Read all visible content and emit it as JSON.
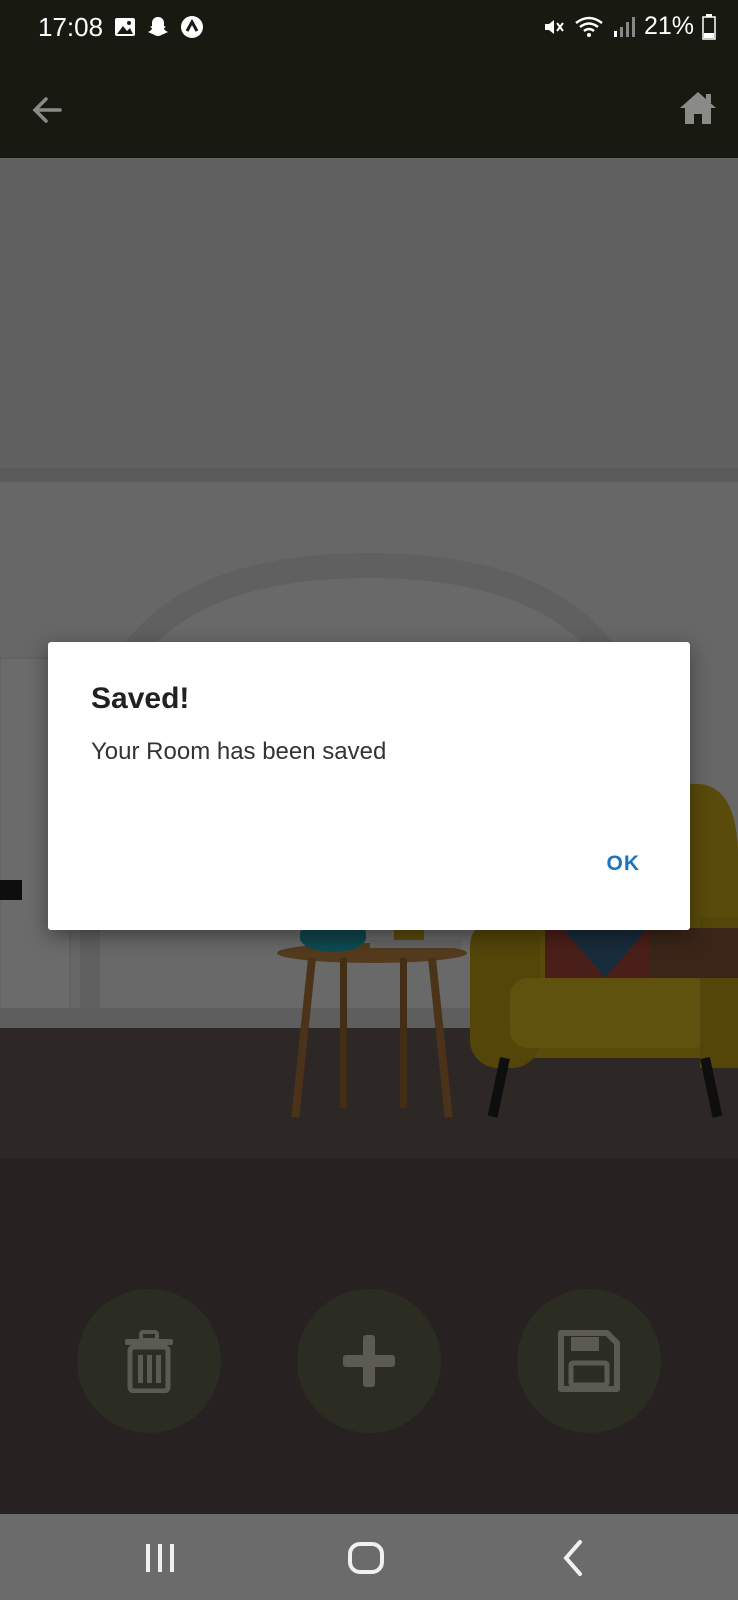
{
  "status_bar": {
    "time": "17:08",
    "battery": "21%",
    "left_icons": [
      "image-icon",
      "snapchat-icon",
      "app-icon"
    ],
    "right_icons": [
      "mute-icon",
      "wifi-icon",
      "signal-icon",
      "battery-icon"
    ]
  },
  "app_bar": {
    "back_icon": "arrow-left-icon",
    "home_icon": "home-icon"
  },
  "dialog": {
    "title": "Saved!",
    "message": "Your Room has been saved",
    "ok_label": "OK",
    "accent_color": "#1e73be"
  },
  "actions": {
    "delete_icon": "trash-icon",
    "add_icon": "plus-icon",
    "save_icon": "floppy-disk-icon"
  },
  "nav_bar": {
    "recents_icon": "recents-icon",
    "home_icon": "home-circle-icon",
    "back_icon": "chevron-left-icon"
  }
}
